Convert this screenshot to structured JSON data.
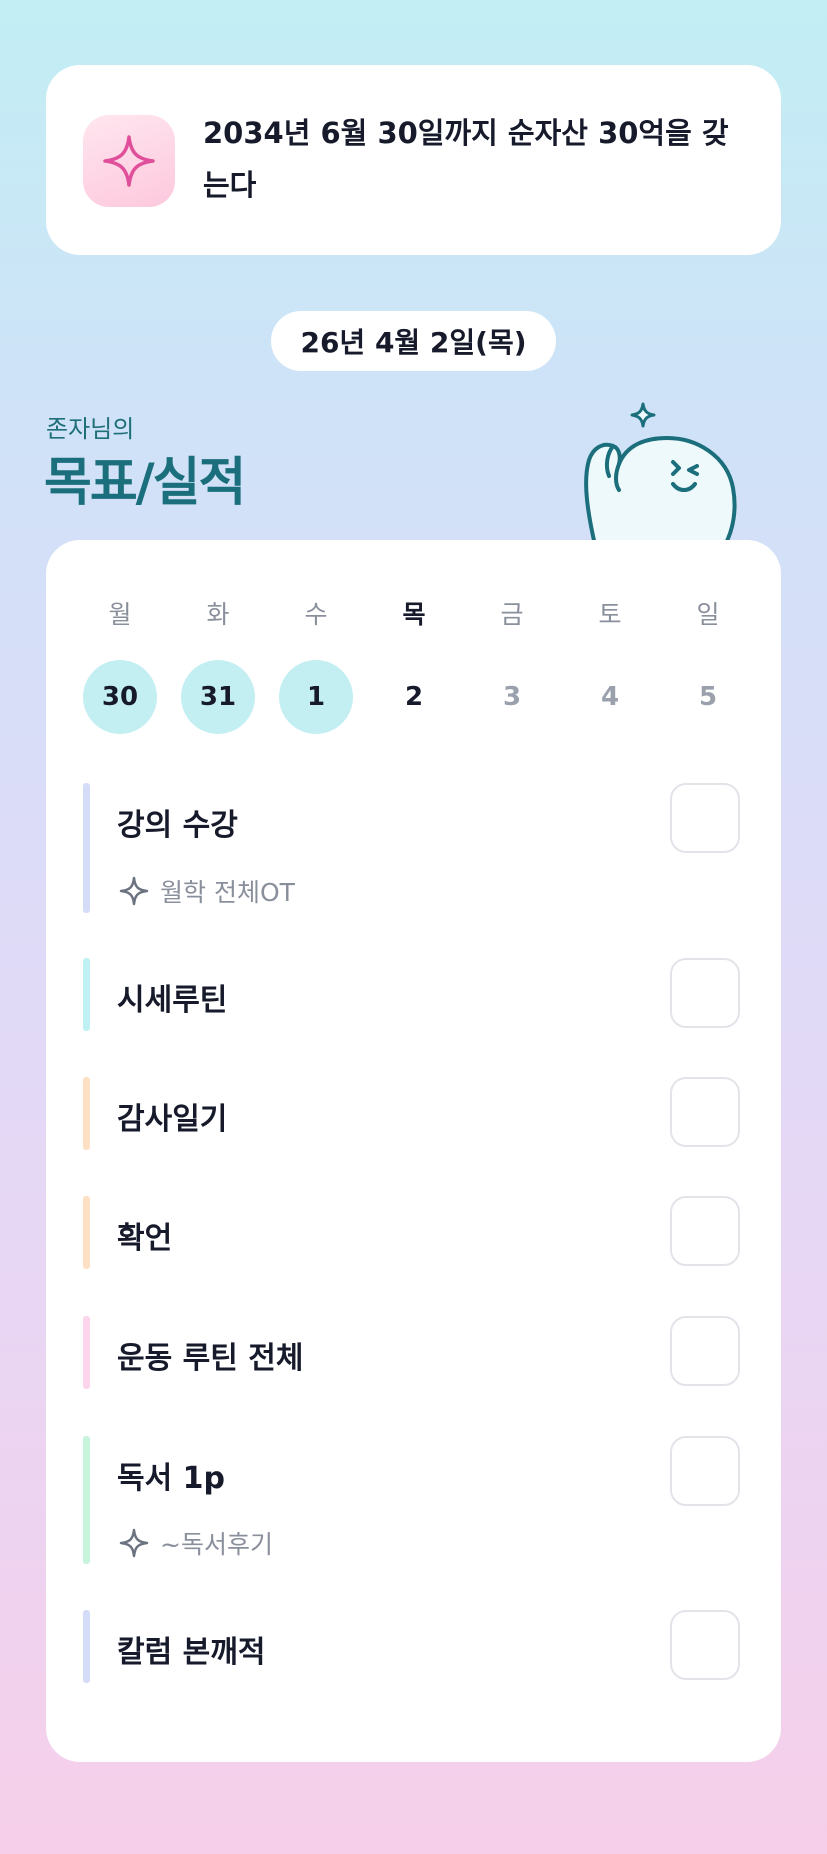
{
  "goal": {
    "text": "2034년 6월 30일까지 순자산 30억을 갖는다",
    "icon": "sparkle-icon"
  },
  "date_label": "26년 4월 2일(목)",
  "header": {
    "subtitle": "존자님의",
    "title": "목표/실적"
  },
  "week": {
    "days": [
      {
        "label": "월",
        "date": "30",
        "status": "done"
      },
      {
        "label": "화",
        "date": "31",
        "status": "done"
      },
      {
        "label": "수",
        "date": "1",
        "status": "done"
      },
      {
        "label": "목",
        "date": "2",
        "status": "today"
      },
      {
        "label": "금",
        "date": "3",
        "status": "future"
      },
      {
        "label": "토",
        "date": "4",
        "status": "future"
      },
      {
        "label": "일",
        "date": "5",
        "status": "future"
      }
    ]
  },
  "tasks": [
    {
      "title": "강의 수강",
      "sub": "월학 전체OT",
      "color": "#d4dcf7",
      "checked": false
    },
    {
      "title": "시세루틴",
      "sub": "",
      "color": "#bff0f4",
      "checked": false
    },
    {
      "title": "감사일기",
      "sub": "",
      "color": "#fde0c4",
      "checked": false
    },
    {
      "title": "확언",
      "sub": "",
      "color": "#fde0c4",
      "checked": false
    },
    {
      "title": "운동 루틴 전체",
      "sub": "",
      "color": "#fcd4ec",
      "checked": false
    },
    {
      "title": "독서 1p",
      "sub": "~독서후기",
      "color": "#c8f3dd",
      "checked": false
    },
    {
      "title": "칼럼 본깨적",
      "sub": "",
      "color": "#d4dcf7",
      "checked": false
    }
  ],
  "colors": {
    "accent": "#1b6e7b",
    "done_day": "#c3eff3",
    "sparkle_pink": "#e0509a"
  }
}
